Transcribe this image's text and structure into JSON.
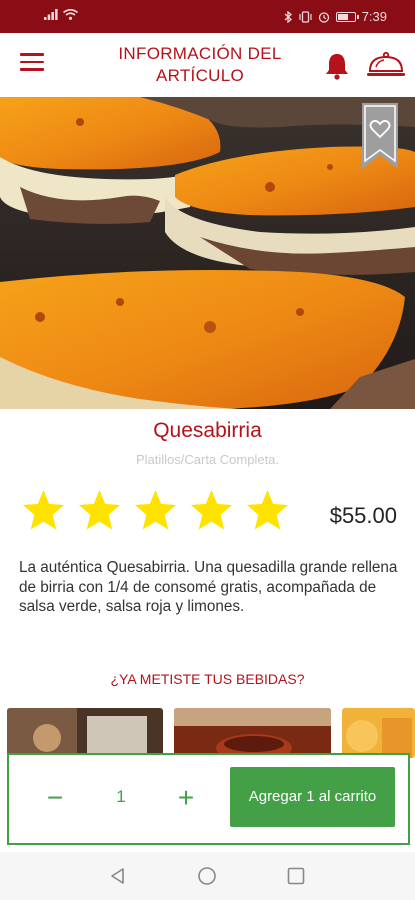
{
  "status_bar": {
    "time": "7:39",
    "battery_level": 0.7,
    "left_icons": [
      "signal-icon",
      "wifi-icon"
    ],
    "right_icons": [
      "bluetooth-icon",
      "vibrate-icon",
      "alarm-icon",
      "battery-icon"
    ]
  },
  "header": {
    "title_line1": "INFORMACIÓN DEL",
    "title_line2": "ARTÍCULO",
    "menu_icon": "hamburger-menu-icon",
    "bell_icon": "bell-icon",
    "cart_icon": "cloche-dish-icon"
  },
  "colors": {
    "brand": "#b5121b",
    "status_bar": "#8a0c15",
    "accent_green": "#43a047"
  },
  "product": {
    "name": "Quesabirria",
    "category": "Platillos/Carta Completa.",
    "rating": 5,
    "rating_max": 5,
    "price": "$55.00",
    "description": "La auténtica Quesabirria. Una quesadilla grande rellena de birria con 1/4 de consomé gratis, acompañada de salsa verde, salsa roja y limones.",
    "favorite_icon": "heart-ribbon-icon"
  },
  "drinks_prompt": "¿YA METISTE TUS BEBIDAS?",
  "cart": {
    "minus": "−",
    "quantity": "1",
    "plus": "+",
    "add_button": "Agregar 1 al carrito"
  },
  "navigation": {
    "back_icon": "back-triangle-icon",
    "home_icon": "home-circle-icon",
    "recent_icon": "recent-apps-square-icon"
  }
}
